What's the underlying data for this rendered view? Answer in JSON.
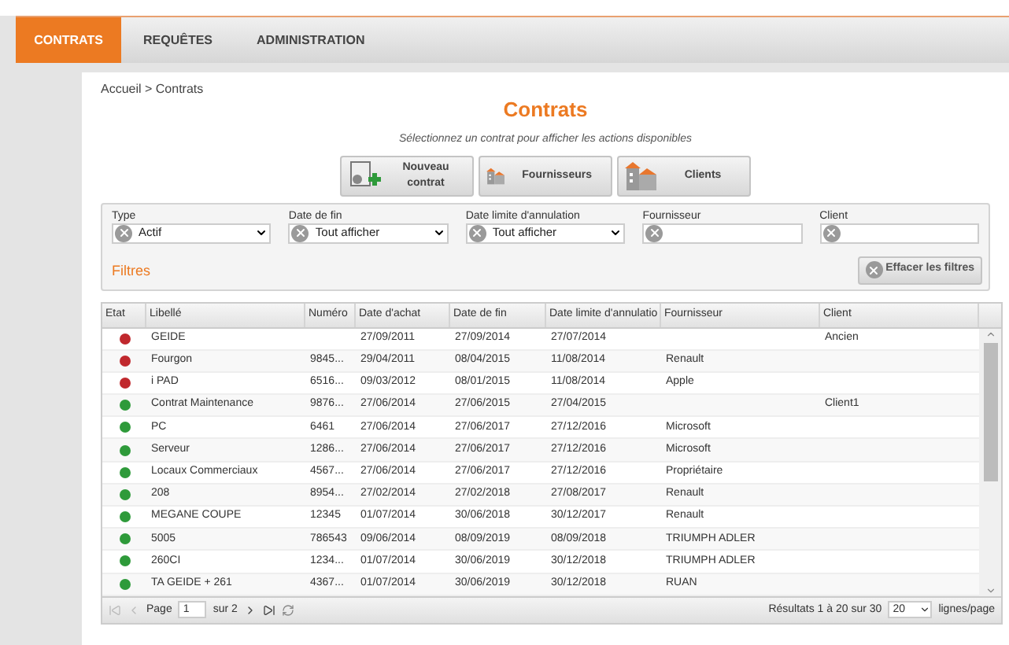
{
  "nav": {
    "tabs": [
      {
        "label": "CONTRATS",
        "selected": true
      },
      {
        "label": "REQUÊTES",
        "selected": false
      },
      {
        "label": "ADMINISTRATION",
        "selected": false
      }
    ]
  },
  "breadcrumb": "Accueil > Contrats",
  "title": "Contrats",
  "subtitle": "Sélectionnez un contrat pour afficher les actions disponibles",
  "actions": [
    {
      "kind": "new",
      "label": "Nouveau contrat"
    },
    {
      "kind": "building",
      "label": "Fournisseurs"
    },
    {
      "kind": "building",
      "label": "Clients"
    }
  ],
  "filters": {
    "fields": [
      {
        "kind": "select",
        "label": "Type",
        "value": "Actif"
      },
      {
        "kind": "select",
        "label": "Date de fin",
        "value": "Tout afficher"
      },
      {
        "kind": "select",
        "label": "Date limite d'annulation",
        "value": "Tout afficher"
      },
      {
        "kind": "text",
        "label": "Fournisseur"
      },
      {
        "kind": "text",
        "label": "Client"
      }
    ],
    "heading": "Filtres",
    "clear_button": "Effacer les filtres"
  },
  "table": {
    "columns": [
      "Etat",
      "Libellé",
      "Numéro",
      "Date d'achat",
      "Date de fin",
      "Date limite d'annulatio",
      "Fournisseur",
      "Client"
    ],
    "rows": [
      {
        "color": "#c0282d",
        "cells": [
          "",
          "GEIDE",
          "",
          "27/09/2011",
          "27/09/2014",
          "27/07/2014",
          "",
          "Ancien"
        ]
      },
      {
        "color": "#c0282d",
        "cells": [
          "",
          "Fourgon",
          "9845...",
          "29/04/2011",
          "08/04/2015",
          "11/08/2014",
          "Renault",
          ""
        ]
      },
      {
        "color": "#c0282d",
        "cells": [
          "",
          "i PAD",
          "6516...",
          "09/03/2012",
          "08/01/2015",
          "11/08/2014",
          "Apple",
          ""
        ]
      },
      {
        "color": "#2e9a3a",
        "cells": [
          "",
          "Contrat Maintenance",
          "9876...",
          "27/06/2014",
          "27/06/2015",
          "27/04/2015",
          "",
          "Client1"
        ]
      },
      {
        "color": "#2e9a3a",
        "cells": [
          "",
          "PC",
          "6461",
          "27/06/2014",
          "27/06/2017",
          "27/12/2016",
          "Microsoft",
          ""
        ]
      },
      {
        "color": "#2e9a3a",
        "cells": [
          "",
          "Serveur",
          "1286...",
          "27/06/2014",
          "27/06/2017",
          "27/12/2016",
          "Microsoft",
          ""
        ]
      },
      {
        "color": "#2e9a3a",
        "cells": [
          "",
          "Locaux Commerciaux",
          "4567...",
          "27/06/2014",
          "27/06/2017",
          "27/12/2016",
          "Propriétaire",
          ""
        ]
      },
      {
        "color": "#2e9a3a",
        "cells": [
          "",
          "208",
          "8954...",
          "27/02/2014",
          "27/02/2018",
          "27/08/2017",
          "Renault",
          ""
        ]
      },
      {
        "color": "#2e9a3a",
        "cells": [
          "",
          "MEGANE COUPE",
          "12345",
          "01/07/2014",
          "30/06/2018",
          "30/12/2017",
          "Renault",
          ""
        ]
      },
      {
        "color": "#2e9a3a",
        "cells": [
          "",
          "5005",
          "786543",
          "09/06/2014",
          "08/09/2019",
          "08/09/2018",
          "TRIUMPH ADLER",
          ""
        ]
      },
      {
        "color": "#2e9a3a",
        "cells": [
          "",
          "260CI",
          "1234...",
          "01/07/2014",
          "30/06/2019",
          "30/12/2018",
          "TRIUMPH ADLER",
          ""
        ]
      },
      {
        "color": "#2e9a3a",
        "cells": [
          "",
          "TA GEIDE + 261",
          "4367...",
          "01/07/2014",
          "30/06/2019",
          "30/12/2018",
          "RUAN",
          ""
        ]
      }
    ]
  },
  "pager": {
    "page_label": "Page",
    "page": "1",
    "of": "sur 2",
    "results": "Résultats 1 à 20 sur 30",
    "per_page": "20",
    "per_page_label": "lignes/page"
  }
}
